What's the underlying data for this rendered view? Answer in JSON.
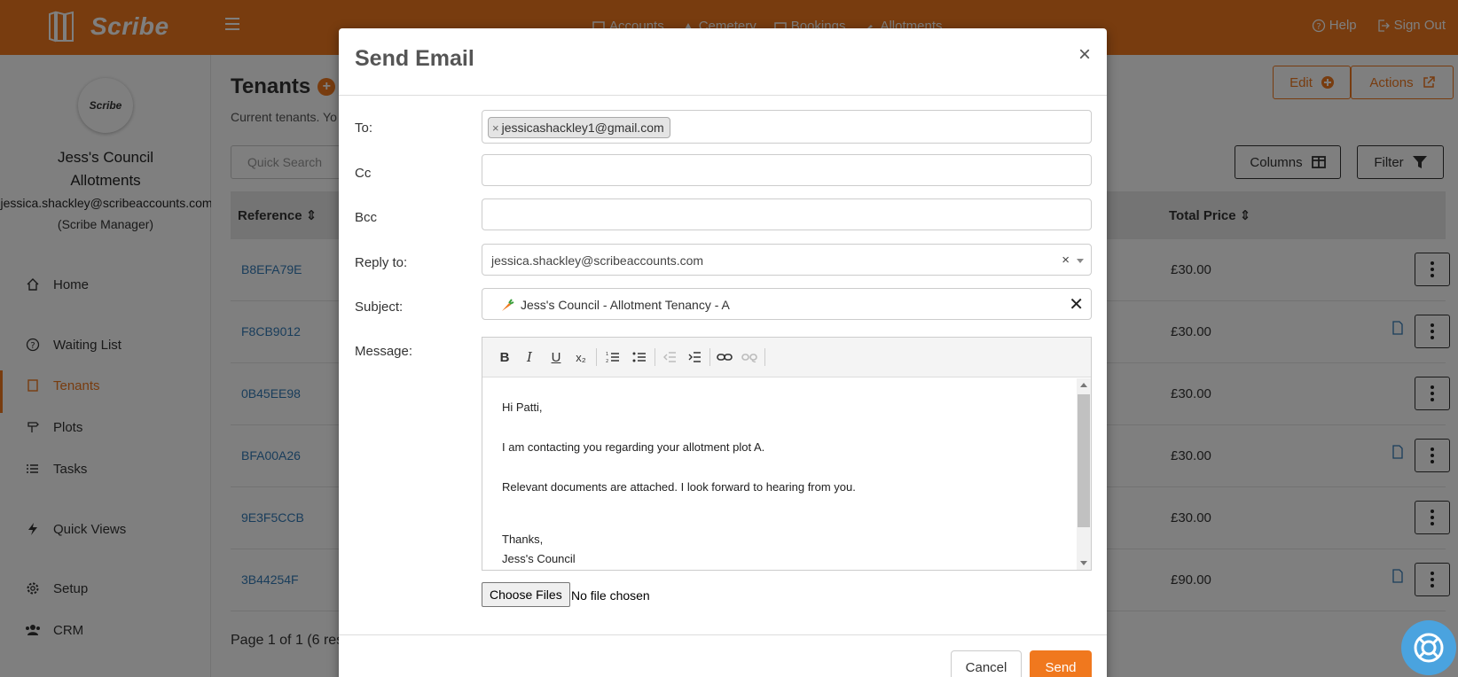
{
  "app": {
    "logo_text": "Scribe",
    "nav": [
      "Accounts",
      "Cemetery",
      "Bookings",
      "Allotments"
    ],
    "help_label": "Help",
    "signout_label": "Sign Out"
  },
  "sidebar": {
    "avatar_text": "Scribe",
    "org_name": "Jess's Council",
    "module": "Allotments",
    "email": "jessica.shackley@scribeaccounts.com",
    "role": "(Scribe Manager)",
    "items": [
      {
        "label": "Home",
        "icon": "home-icon"
      },
      {
        "label": "Waiting List",
        "icon": "question-circle-icon"
      },
      {
        "label": "Tenants",
        "icon": "book-icon",
        "active": true
      },
      {
        "label": "Plots",
        "icon": "signpost-icon"
      },
      {
        "label": "Tasks",
        "icon": "list-icon"
      },
      {
        "label": "Quick Views",
        "icon": "bolt-icon"
      },
      {
        "label": "Setup",
        "icon": "gear-icon"
      },
      {
        "label": "CRM",
        "icon": "users-icon"
      }
    ]
  },
  "main": {
    "title": "Tenants",
    "description": "Current tenants. Yo",
    "edit_label": "Edit",
    "actions_label": "Actions",
    "search_placeholder": "Quick Search",
    "columns_label": "Columns",
    "filter_label": "Filter",
    "col_reference": "Reference",
    "col_total_price": "Total Price",
    "rows": [
      {
        "ref": "B8EFA79E",
        "price": "£30.00",
        "doc": false
      },
      {
        "ref": "F8CB9012",
        "price": "£30.00",
        "doc": true
      },
      {
        "ref": "0B45EE98",
        "price": "£30.00",
        "doc": false
      },
      {
        "ref": "BFA00A26",
        "price": "£30.00",
        "doc": true
      },
      {
        "ref": "9E3F5CCB",
        "price": "£30.00",
        "doc": false
      },
      {
        "ref": "3B44254F",
        "price": "£90.00",
        "doc": true
      }
    ],
    "pager": "Page 1 of 1 (6 resu"
  },
  "modal": {
    "title": "Send Email",
    "close_glyph": "×",
    "to_label": "To:",
    "to_tag": "jessicashackley1@gmail.com",
    "cc_label": "Cc",
    "bcc_label": "Bcc",
    "reply_label": "Reply to:",
    "reply_value": "jessica.shackley@scribeaccounts.com",
    "subject_label": "Subject:",
    "subject_value": "Jess's Council - Allotment Tenancy -  A",
    "message_label": "Message:",
    "message_lines": [
      "Hi Patti,",
      "I am contacting you regarding your allotment plot A.",
      "Relevant documents are attached.  I look forward to hearing from you.",
      "Thanks,",
      "Jess's Council"
    ],
    "file_button": "Choose Files",
    "file_status": "No file chosen",
    "cancel_label": "Cancel",
    "send_label": "Send"
  },
  "colors": {
    "brand": "#f0781e",
    "link": "#337ab7",
    "help_bubble": "#4aa3df"
  }
}
